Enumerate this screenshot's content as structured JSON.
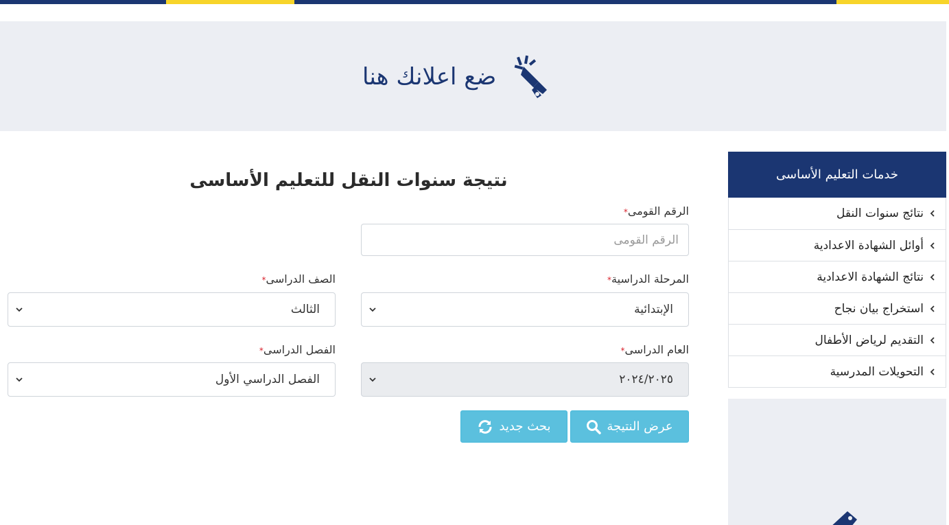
{
  "banner": {
    "ad_text": "ضع اعلانك هنا",
    "icon": "megaphone-icon"
  },
  "sidebar": {
    "title": "خدمات التعليم الأساسى",
    "items": [
      {
        "label": "نتائج سنوات النقل"
      },
      {
        "label": "أوائل الشهادة الاعدادية"
      },
      {
        "label": "نتائج الشهادة الاعدادية"
      },
      {
        "label": "استخراج بيان نجاح"
      },
      {
        "label": "التقديم لرياض الأطفال"
      },
      {
        "label": "التحويلات المدرسية"
      }
    ]
  },
  "form": {
    "title": "نتيجة سنوات النقل للتعليم الأساسى",
    "required_mark": "*",
    "national_id": {
      "label": "الرقم القومى",
      "placeholder": "الرقم القومى",
      "value": ""
    },
    "stage": {
      "label": "المرحلة الدراسية",
      "value": "الإبتدائية"
    },
    "grade": {
      "label": "الصف الدراسى",
      "value": "الثالث"
    },
    "year": {
      "label": "العام الدراسى",
      "value": "٢٠٢٤/٢٠٢٥"
    },
    "term": {
      "label": "الفصل الدراسى",
      "value": "الفصل الدراسي الأول"
    },
    "show_result_label": "عرض النتيجة",
    "new_search_label": "بحث جديد"
  },
  "colors": {
    "brand_navy": "#1b3672",
    "brand_yellow": "#f7d42a",
    "button": "#5bc0de",
    "required": "#d9232d"
  }
}
